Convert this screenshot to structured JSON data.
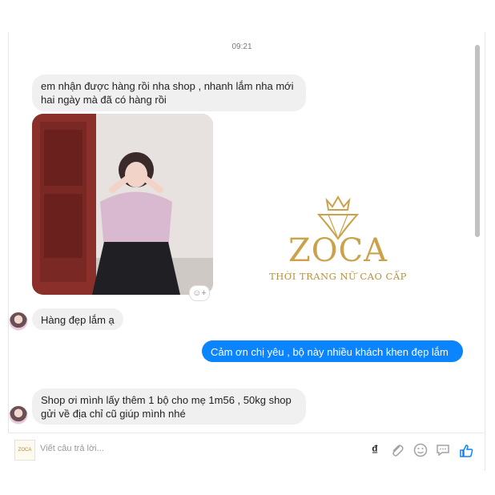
{
  "chat": {
    "timestamp": "09:21",
    "messages": [
      {
        "direction": "in",
        "text_lines": [
          "em nhận được hàng rồi nha shop , nhanh lắm nha mới",
          "hai ngày mà đã có hàng rồi"
        ]
      },
      {
        "direction": "in",
        "type": "photo"
      },
      {
        "direction": "in",
        "text": "Hàng đẹp lắm ạ"
      },
      {
        "direction": "out",
        "text": "Cảm ơn chị yêu , bộ này nhiều khách khen đẹp lắm ạ"
      },
      {
        "direction": "in",
        "text_lines": [
          "Shop ơi mình lấy thêm 1 bộ cho mẹ 1m56 , 50kg shop",
          "gửi về địa chỉ cũ giúp mình nhé"
        ]
      }
    ]
  },
  "brand": {
    "name": "ZOCA",
    "tagline": "THỜI TRANG NỮ CAO CẤP",
    "color": "#caa24a"
  },
  "composer": {
    "placeholder": "Viết câu trả lời...",
    "icons": [
      "dong-icon",
      "paperclip-icon",
      "emoji-icon",
      "quick-reply-icon",
      "like-icon"
    ],
    "currency_symbol": "₫"
  },
  "colors": {
    "outgoing": "#0a84ff",
    "incoming": "#f0f0f0"
  }
}
